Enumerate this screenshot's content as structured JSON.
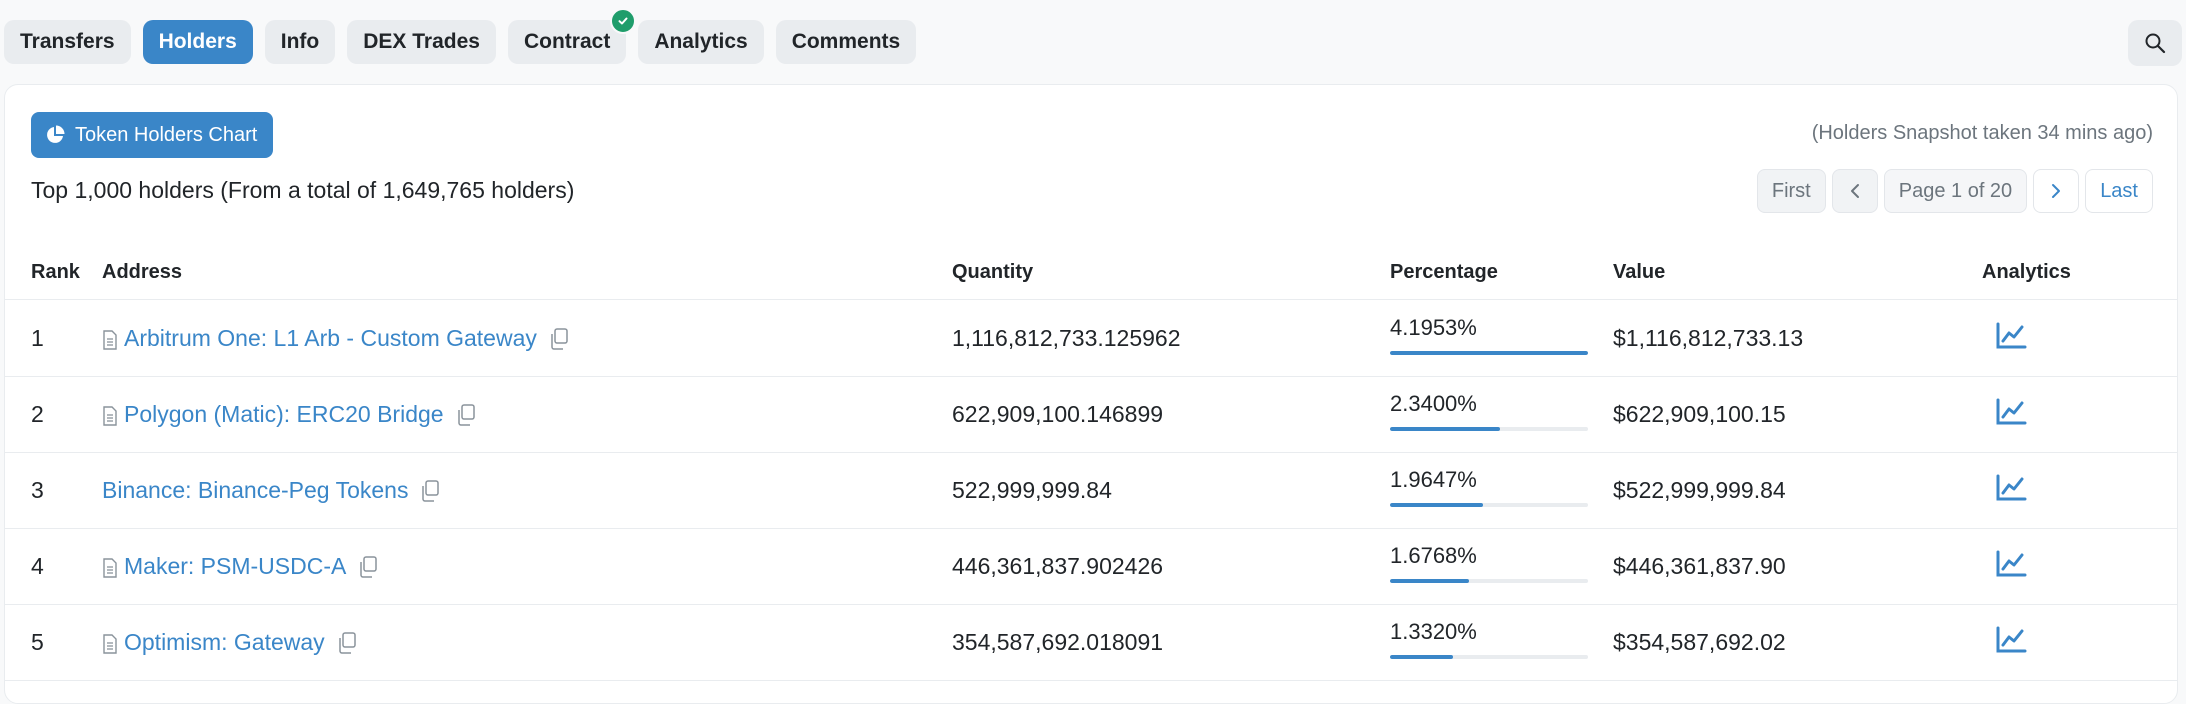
{
  "tabs": [
    {
      "label": "Transfers",
      "active": false
    },
    {
      "label": "Holders",
      "active": true
    },
    {
      "label": "Info",
      "active": false
    },
    {
      "label": "DEX Trades",
      "active": false
    },
    {
      "label": "Contract",
      "active": false,
      "verified": true
    },
    {
      "label": "Analytics",
      "active": false
    },
    {
      "label": "Comments",
      "active": false
    }
  ],
  "toolbar": {
    "chart_button_label": "Token Holders Chart",
    "snapshot_text": "(Holders Snapshot taken 34 mins ago)",
    "summary_text": "Top 1,000 holders (From a total of 1,649,765 holders)"
  },
  "pager": {
    "first_label": "First",
    "page_info": "Page 1 of 20",
    "last_label": "Last"
  },
  "table": {
    "headers": {
      "rank": "Rank",
      "address": "Address",
      "quantity": "Quantity",
      "percentage": "Percentage",
      "value": "Value",
      "analytics": "Analytics"
    },
    "rows": [
      {
        "rank": "1",
        "address": "Arbitrum One: L1 Arb - Custom Gateway",
        "contract": true,
        "quantity": "1,116,812,733.125962",
        "percentage": "4.1953%",
        "bar_fraction": 1.0,
        "value": "$1,116,812,733.13"
      },
      {
        "rank": "2",
        "address": "Polygon (Matic): ERC20 Bridge",
        "contract": true,
        "quantity": "622,909,100.146899",
        "percentage": "2.3400%",
        "bar_fraction": 0.558,
        "value": "$622,909,100.15"
      },
      {
        "rank": "3",
        "address": "Binance: Binance-Peg Tokens",
        "contract": false,
        "quantity": "522,999,999.84",
        "percentage": "1.9647%",
        "bar_fraction": 0.468,
        "value": "$522,999,999.84"
      },
      {
        "rank": "4",
        "address": "Maker: PSM-USDC-A",
        "contract": true,
        "quantity": "446,361,837.902426",
        "percentage": "1.6768%",
        "bar_fraction": 0.4,
        "value": "$446,361,837.90"
      },
      {
        "rank": "5",
        "address": "Optimism: Gateway",
        "contract": true,
        "quantity": "354,587,692.018091",
        "percentage": "1.3320%",
        "bar_fraction": 0.318,
        "value": "$354,587,692.02"
      }
    ]
  },
  "colors": {
    "accent": "#3a86c8",
    "verified": "#1f9d6b",
    "tab_bg": "#e9ecef"
  }
}
